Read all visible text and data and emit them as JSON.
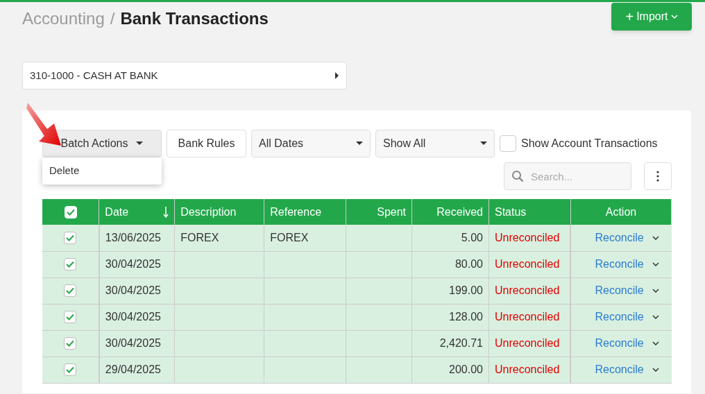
{
  "breadcrumb": {
    "parent": "Accounting",
    "separator": "/",
    "current": "Bank Transactions"
  },
  "import_button": {
    "icon": "+",
    "label": "Import"
  },
  "account_select": {
    "value": "310-1000 - CASH AT BANK"
  },
  "toolbar": {
    "batch_actions": "Batch Actions",
    "bank_rules": "Bank Rules",
    "date_filter": "All Dates",
    "status_filter": "Show All",
    "show_account_transactions": {
      "label": "Show Account Transactions",
      "checked": false
    }
  },
  "batch_menu": {
    "expanded": true,
    "items": [
      "Delete"
    ]
  },
  "search": {
    "placeholder": "Search..."
  },
  "table": {
    "all_checked": true,
    "columns": [
      {
        "label": "Date",
        "sorted": true
      },
      {
        "label": "Description",
        "sorted": false
      },
      {
        "label": "Reference",
        "sorted": false
      },
      {
        "label": "Spent",
        "sorted": false
      },
      {
        "label": "Received",
        "sorted": false
      },
      {
        "label": "Status",
        "sorted": false
      },
      {
        "label": "Action",
        "sorted": false
      }
    ],
    "rows": [
      {
        "checked": true,
        "date": "13/06/2025",
        "description": "FOREX",
        "reference": "FOREX",
        "spent": "",
        "received": "5.00",
        "status": "Unreconciled",
        "action": "Reconcile"
      },
      {
        "checked": true,
        "date": "30/04/2025",
        "description": "",
        "reference": "",
        "spent": "",
        "received": "80.00",
        "status": "Unreconciled",
        "action": "Reconcile"
      },
      {
        "checked": true,
        "date": "30/04/2025",
        "description": "",
        "reference": "",
        "spent": "",
        "received": "199.00",
        "status": "Unreconciled",
        "action": "Reconcile"
      },
      {
        "checked": true,
        "date": "30/04/2025",
        "description": "",
        "reference": "",
        "spent": "",
        "received": "128.00",
        "status": "Unreconciled",
        "action": "Reconcile"
      },
      {
        "checked": true,
        "date": "30/04/2025",
        "description": "",
        "reference": "",
        "spent": "",
        "received": "2,420.71",
        "status": "Unreconciled",
        "action": "Reconcile"
      },
      {
        "checked": true,
        "date": "29/04/2025",
        "description": "",
        "reference": "",
        "spent": "",
        "received": "200.00",
        "status": "Unreconciled",
        "action": "Reconcile"
      }
    ]
  }
}
